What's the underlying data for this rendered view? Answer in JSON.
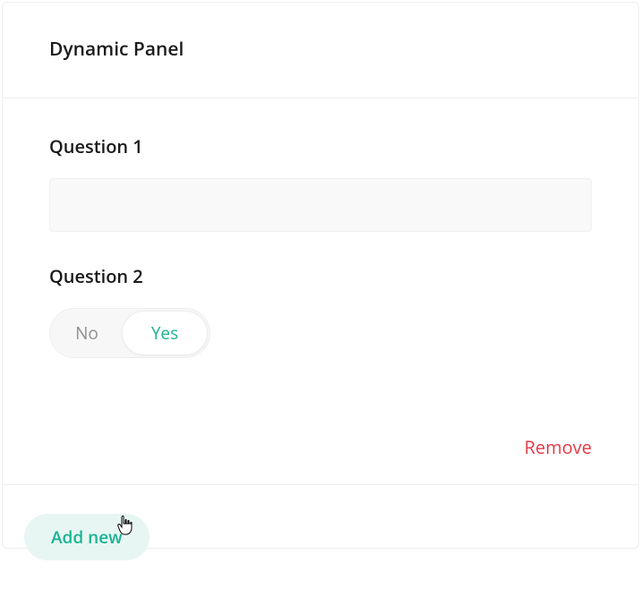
{
  "panel": {
    "title": "Dynamic Panel"
  },
  "questions": {
    "q1": {
      "title": "Question 1",
      "value": ""
    },
    "q2": {
      "title": "Question 2",
      "options": {
        "no": "No",
        "yes": "Yes"
      },
      "selected": "yes"
    }
  },
  "actions": {
    "remove": "Remove",
    "add_new": "Add new"
  },
  "colors": {
    "accent": "#19b394",
    "accent_bg": "#e7f6f2",
    "danger": "#e63946",
    "text": "#1a1a1a",
    "muted": "#909090",
    "input_bg": "#f9f9f9",
    "border": "#eeeeee"
  }
}
